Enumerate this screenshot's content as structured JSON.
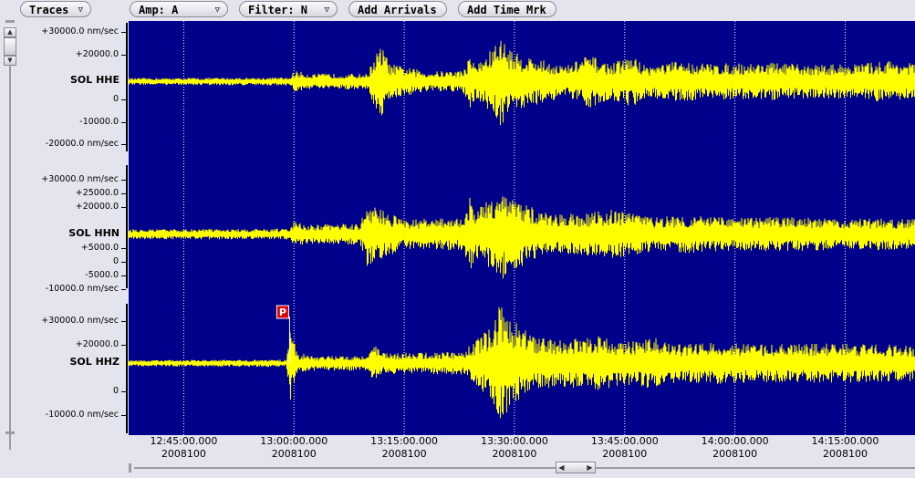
{
  "toolbar": {
    "traces_label": "Traces",
    "amp_label": "Amp: A",
    "filter_label": "Filter: N",
    "add_arrivals_label": "Add Arrivals",
    "add_time_mark_label": "Add Time Mrk",
    "dropdown_icon": "triangle-down-icon"
  },
  "colors": {
    "plot_background": "#00008b",
    "trace": "#ffff00",
    "gridline": "#ffffff",
    "pick_marker": "#dd0000"
  },
  "chart_data": {
    "type": "line",
    "xlabel": "",
    "x_ticks": [
      {
        "time": "12:45:00.000",
        "date": "2008100"
      },
      {
        "time": "13:00:00.000",
        "date": "2008100"
      },
      {
        "time": "13:15:00.000",
        "date": "2008100"
      },
      {
        "time": "13:30:00.000",
        "date": "2008100"
      },
      {
        "time": "13:45:00.000",
        "date": "2008100"
      },
      {
        "time": "14:00:00.000",
        "date": "2008100"
      },
      {
        "time": "14:15:00.000",
        "date": "2008100"
      }
    ],
    "x_range_minutes": [
      -7.5,
      99.5
    ],
    "grid": true,
    "series": [
      {
        "name": "SOL HHE",
        "ylim": [
          -24000,
          35000
        ],
        "y_ticks": [
          {
            "value": 30000,
            "label": "+30000.0 nm/sec"
          },
          {
            "value": 20000,
            "label": "+20000.0"
          },
          {
            "value": 0,
            "label": "0"
          },
          {
            "value": -10000,
            "label": "-10000.0"
          },
          {
            "value": -20000,
            "label": "-20000.0 nm/sec"
          }
        ],
        "baseline": 8000,
        "envelope": [
          [
            -7.5,
            1500
          ],
          [
            14.5,
            1800
          ],
          [
            15,
            5000
          ],
          [
            17,
            3500
          ],
          [
            25,
            3500
          ],
          [
            26,
            12000
          ],
          [
            27,
            16000
          ],
          [
            28,
            8000
          ],
          [
            33,
            4500
          ],
          [
            38,
            5000
          ],
          [
            39,
            12000
          ],
          [
            40,
            8000
          ],
          [
            42,
            15000
          ],
          [
            43,
            20000
          ],
          [
            45,
            13000
          ],
          [
            49,
            9500
          ],
          [
            52,
            7000
          ],
          [
            55,
            12000
          ],
          [
            58,
            8000
          ],
          [
            61,
            11500
          ],
          [
            63,
            7000
          ],
          [
            67,
            9000
          ],
          [
            72,
            8000
          ],
          [
            80,
            8500
          ],
          [
            85,
            7500
          ],
          [
            92,
            8000
          ],
          [
            96,
            9500
          ],
          [
            99.5,
            8000
          ]
        ]
      },
      {
        "name": "SOL HHN",
        "ylim": [
          -10500,
          36000
        ],
        "y_ticks": [
          {
            "value": 30000,
            "label": "+30000.0 nm/sec"
          },
          {
            "value": 25000,
            "label": "+25000.0"
          },
          {
            "value": 20000,
            "label": "+20000.0"
          },
          {
            "value": 5000,
            "label": "+5000.0"
          },
          {
            "value": 0,
            "label": "0"
          },
          {
            "value": -5000,
            "label": "-5000.0"
          },
          {
            "value": -10000,
            "label": "-10000.0 nm/sec"
          }
        ],
        "baseline": 10000,
        "envelope": [
          [
            -7.5,
            1800
          ],
          [
            14.5,
            2000
          ],
          [
            15,
            5000
          ],
          [
            17,
            3500
          ],
          [
            24,
            4000
          ],
          [
            25,
            12000
          ],
          [
            27,
            9000
          ],
          [
            30,
            5500
          ],
          [
            38,
            6000
          ],
          [
            39,
            14000
          ],
          [
            40,
            9000
          ],
          [
            42,
            14000
          ],
          [
            43,
            18000
          ],
          [
            45,
            13000
          ],
          [
            49,
            8000
          ],
          [
            54,
            7500
          ],
          [
            58,
            9000
          ],
          [
            64,
            6500
          ],
          [
            68,
            7000
          ],
          [
            75,
            6000
          ],
          [
            82,
            6500
          ],
          [
            90,
            5500
          ],
          [
            96,
            6000
          ],
          [
            99.5,
            5500
          ]
        ]
      },
      {
        "name": "SOL HHZ",
        "ylim": [
          -18500,
          38000
        ],
        "y_ticks": [
          {
            "value": 30000,
            "label": "+30000.0 nm/sec"
          },
          {
            "value": 20000,
            "label": "+20000.0"
          },
          {
            "value": 0,
            "label": "0"
          },
          {
            "value": -10000,
            "label": "-10000.0 nm/sec"
          }
        ],
        "baseline": 12000,
        "pick": {
          "label": "P",
          "x_minutes": 14.4
        },
        "envelope": [
          [
            -7.5,
            1300
          ],
          [
            14,
            1500
          ],
          [
            14.5,
            17000
          ],
          [
            15.5,
            4500
          ],
          [
            18,
            3000
          ],
          [
            25,
            3500
          ],
          [
            26,
            8000
          ],
          [
            27,
            4500
          ],
          [
            33,
            4500
          ],
          [
            38,
            5000
          ],
          [
            39,
            8000
          ],
          [
            42,
            16000
          ],
          [
            43,
            25000
          ],
          [
            45,
            18000
          ],
          [
            48,
            11000
          ],
          [
            52,
            10000
          ],
          [
            56,
            12000
          ],
          [
            60,
            9000
          ],
          [
            64,
            11000
          ],
          [
            67,
            8000
          ],
          [
            72,
            9000
          ],
          [
            80,
            8000
          ],
          [
            88,
            8500
          ],
          [
            96,
            8000
          ],
          [
            99.5,
            7500
          ]
        ]
      }
    ]
  }
}
